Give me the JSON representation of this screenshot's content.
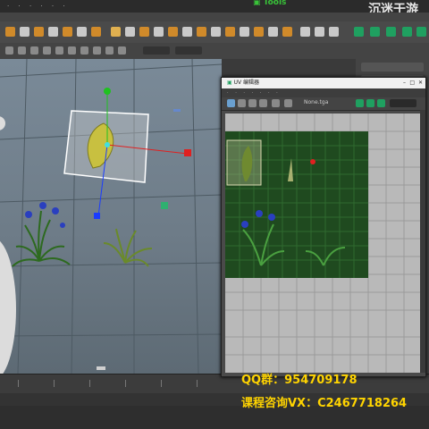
{
  "app": {
    "logo_text": "Tools"
  },
  "overlay": {
    "qq_line": "QQ群：954709178",
    "vx_line": "课程咨询VX：C2467718264",
    "watermark": "沉迷于游"
  },
  "uv_window": {
    "title": "UV 编辑器",
    "file_label": "None.tga"
  },
  "colors": {
    "accent_yellow": "#ffd400",
    "manipulator_red": "#e02020",
    "manipulator_green": "#1fc21f",
    "manipulator_blue": "#1a3cff",
    "texture_green": "#1f4a1f"
  }
}
